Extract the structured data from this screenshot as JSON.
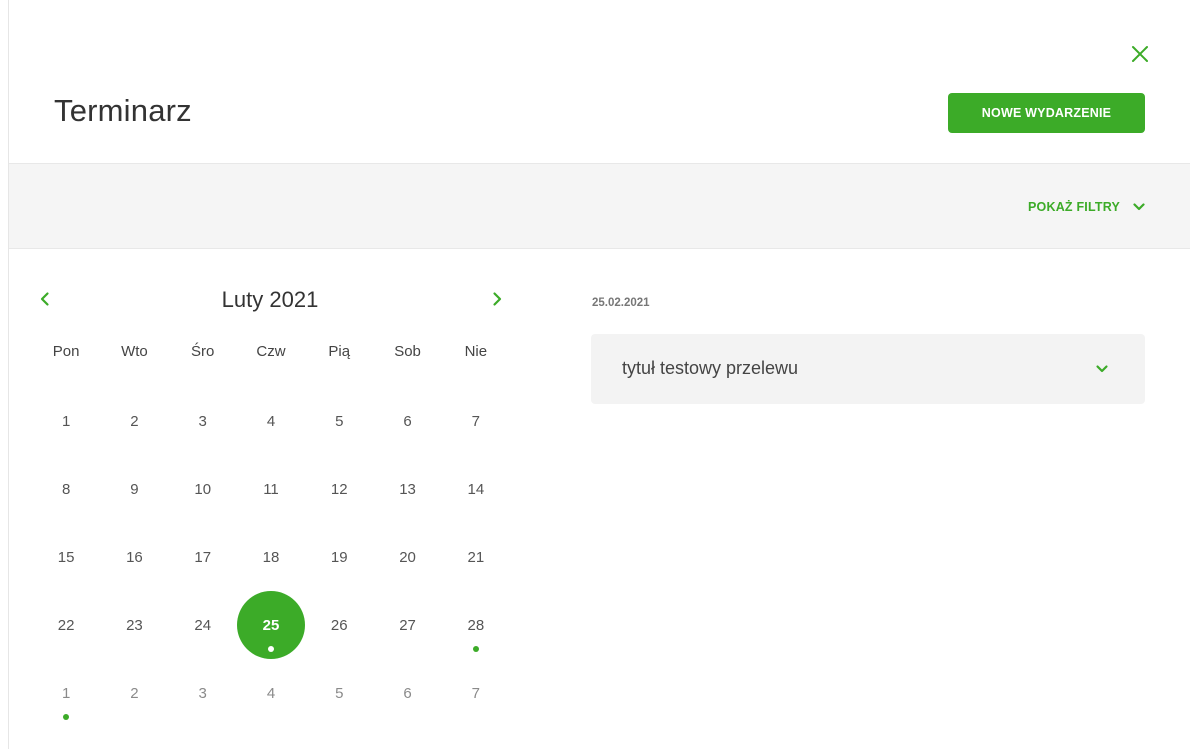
{
  "header": {
    "title": "Terminarz",
    "new_event_label": "NOWE WYDARZENIE",
    "close_icon": "close-icon",
    "accent_color": "#3cab28"
  },
  "filters": {
    "toggle_label": "POKAŻ FILTRY",
    "icon": "chevron-down-icon"
  },
  "calendar": {
    "month_label": "Luty 2021",
    "prev_icon": "chevron-left-icon",
    "next_icon": "chevron-right-icon",
    "weekdays": [
      "Pon",
      "Wto",
      "Śro",
      "Czw",
      "Pią",
      "Sob",
      "Nie"
    ],
    "weeks": [
      [
        {
          "d": "1"
        },
        {
          "d": "2"
        },
        {
          "d": "3"
        },
        {
          "d": "4"
        },
        {
          "d": "5"
        },
        {
          "d": "6"
        },
        {
          "d": "7"
        }
      ],
      [
        {
          "d": "8"
        },
        {
          "d": "9"
        },
        {
          "d": "10"
        },
        {
          "d": "11"
        },
        {
          "d": "12"
        },
        {
          "d": "13"
        },
        {
          "d": "14"
        }
      ],
      [
        {
          "d": "15"
        },
        {
          "d": "16"
        },
        {
          "d": "17"
        },
        {
          "d": "18"
        },
        {
          "d": "19"
        },
        {
          "d": "20"
        },
        {
          "d": "21"
        }
      ],
      [
        {
          "d": "22"
        },
        {
          "d": "23"
        },
        {
          "d": "24"
        },
        {
          "d": "25",
          "selected": true,
          "dot": true
        },
        {
          "d": "26"
        },
        {
          "d": "27"
        },
        {
          "d": "28",
          "dot": true
        }
      ],
      [
        {
          "d": "1",
          "other": true,
          "dot": true
        },
        {
          "d": "2",
          "other": true
        },
        {
          "d": "3",
          "other": true
        },
        {
          "d": "4",
          "other": true
        },
        {
          "d": "5",
          "other": true
        },
        {
          "d": "6",
          "other": true
        },
        {
          "d": "7",
          "other": true
        }
      ]
    ]
  },
  "agenda": {
    "selected_date": "25.02.2021",
    "events": [
      {
        "title": "tytuł testowy przelewu",
        "icon": "chevron-down-icon"
      }
    ]
  }
}
